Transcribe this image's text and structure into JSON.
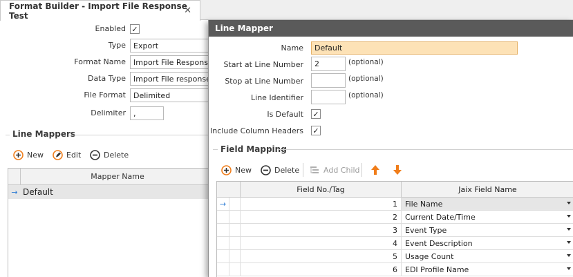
{
  "tab": {
    "title": "Format Builder - Import File Response Test",
    "close": "✕"
  },
  "format": {
    "enabled_label": "Enabled",
    "enabled_checked": "✓",
    "type_label": "Type",
    "type_value": "Export",
    "format_name_label": "Format Name",
    "format_name_value": "Import File Response",
    "data_type_label": "Data Type",
    "data_type_value": "Import File response",
    "file_format_label": "File Format",
    "file_format_value": "Delimited",
    "delimiter_label": "Delimiter",
    "delimiter_value": ","
  },
  "line_mappers": {
    "title": "Line Mappers",
    "new_label": "New",
    "edit_label": "Edit",
    "delete_label": "Delete",
    "column_header": "Mapper Name",
    "row_indicator": "→",
    "rows": [
      "Default"
    ]
  },
  "dialog": {
    "title": "Line Mapper",
    "name_label": "Name",
    "name_value": "Default",
    "start_label": "Start at Line Number",
    "start_value": "2",
    "start_hint": "(optional)",
    "stop_label": "Stop at Line Number",
    "stop_value": "",
    "stop_hint": "(optional)",
    "identifier_label": "Line Identifier",
    "identifier_value": "",
    "identifier_hint": "(optional)",
    "is_default_label": "Is Default",
    "is_default_checked": "✓",
    "include_headers_label": "Include Column Headers",
    "include_headers_checked": "✓"
  },
  "field_mapping": {
    "title": "Field Mapping",
    "new_label": "New",
    "delete_label": "Delete",
    "add_child_label": "Add Child",
    "col_field": "Field No./Tag",
    "col_jaix": "Jaix Field Name",
    "row_indicator": "→",
    "rows": [
      {
        "no": "1",
        "name": "File Name"
      },
      {
        "no": "2",
        "name": "Current Date/Time"
      },
      {
        "no": "3",
        "name": "Event Type"
      },
      {
        "no": "4",
        "name": "Event Description"
      },
      {
        "no": "5",
        "name": "Usage Count"
      },
      {
        "no": "6",
        "name": "EDI Profile Name"
      }
    ]
  },
  "colors": {
    "accent_orange": "#f07d1a",
    "title_bar": "#5a5a5a",
    "name_field_bg": "#fde2b6",
    "indicator_blue": "#2a7bd4"
  }
}
